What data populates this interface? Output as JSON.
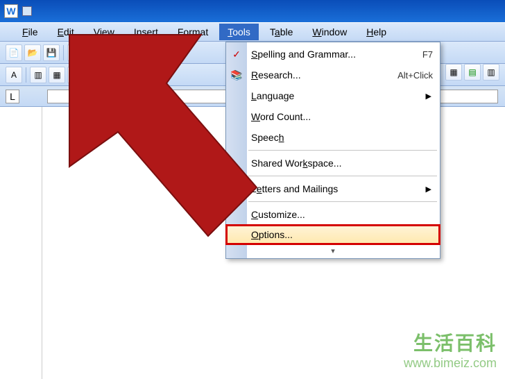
{
  "app": {
    "icon_letter": "W"
  },
  "menubar": {
    "items": [
      {
        "label": "File",
        "mnemonic": "F"
      },
      {
        "label": "Edit",
        "mnemonic": "E"
      },
      {
        "label": "View",
        "mnemonic": "V"
      },
      {
        "label": "Insert",
        "mnemonic": "I"
      },
      {
        "label": "Format",
        "mnemonic": "o"
      },
      {
        "label": "Tools",
        "mnemonic": "T"
      },
      {
        "label": "Table",
        "mnemonic": "a"
      },
      {
        "label": "Window",
        "mnemonic": "W"
      },
      {
        "label": "Help",
        "mnemonic": "H"
      }
    ],
    "active_index": 5
  },
  "dropdown": {
    "items": [
      {
        "label": "Spelling and Grammar...",
        "mnemonic": "S",
        "shortcut": "F7",
        "icon": "spellcheck"
      },
      {
        "label": "Research...",
        "mnemonic": "R",
        "shortcut": "Alt+Click",
        "icon": "research"
      },
      {
        "label": "Language",
        "mnemonic": "L",
        "submenu": true
      },
      {
        "label": "Word Count...",
        "mnemonic": "W"
      },
      {
        "label": "Speech",
        "mnemonic": "h",
        "sep_after": true
      },
      {
        "label": "Shared Workspace...",
        "mnemonic": "k",
        "sep_after": true
      },
      {
        "label": "Letters and Mailings",
        "mnemonic": "e",
        "submenu": true,
        "sep_after": true
      },
      {
        "label": "Customize...",
        "mnemonic": "C"
      },
      {
        "label": "Options...",
        "mnemonic": "O",
        "highlighted": true
      }
    ],
    "expand_glyph": "▾"
  },
  "watermark": {
    "line1": "生活百科",
    "line2": "www.bimeiz.com"
  },
  "ruler": {
    "tab_char": "L"
  }
}
